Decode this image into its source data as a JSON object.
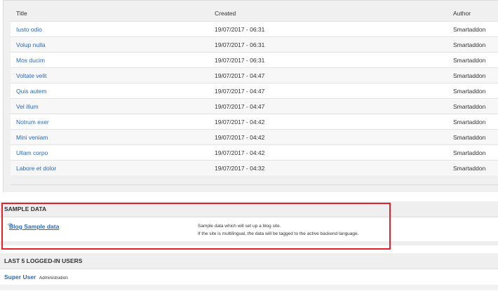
{
  "articles": {
    "headers": {
      "title": "Title",
      "created": "Created",
      "author": "Author"
    },
    "rows": [
      {
        "title": "Iusto odio",
        "created": "19/07/2017 - 06:31",
        "author": "Smartaddon"
      },
      {
        "title": "Volup nulla",
        "created": "19/07/2017 - 06:31",
        "author": "Smartaddon"
      },
      {
        "title": "Mos ducim",
        "created": "19/07/2017 - 06:31",
        "author": "Smartaddon"
      },
      {
        "title": "Voltate velit",
        "created": "19/07/2017 - 04:47",
        "author": "Smartaddon"
      },
      {
        "title": "Quis autem",
        "created": "19/07/2017 - 04:47",
        "author": "Smartaddon"
      },
      {
        "title": "Vel illum",
        "created": "19/07/2017 - 04:47",
        "author": "Smartaddon"
      },
      {
        "title": "Notrum exer",
        "created": "19/07/2017 - 04:42",
        "author": "Smartaddon"
      },
      {
        "title": "Mini veniam",
        "created": "19/07/2017 - 04:42",
        "author": "Smartaddon"
      },
      {
        "title": "Ullam corpo",
        "created": "19/07/2017 - 04:42",
        "author": "Smartaddon"
      },
      {
        "title": "Labore et dolor",
        "created": "19/07/2017 - 04:32",
        "author": "Smartaddon"
      }
    ]
  },
  "sample_data": {
    "heading": "SAMPLE DATA",
    "item_label": "Blog Sample data",
    "icon": "wifi-icon",
    "desc_line1": "Sample data which will set up a blog site.",
    "desc_line2": "If the site is multilingual, the data will be tagged to the active backend language."
  },
  "users": {
    "heading": "LAST 5 LOGGED-IN USERS",
    "rows": [
      {
        "name": "Super User",
        "role": "Administration"
      }
    ]
  },
  "colors": {
    "link": "#2a69b8",
    "highlight_border": "#e0202a"
  }
}
